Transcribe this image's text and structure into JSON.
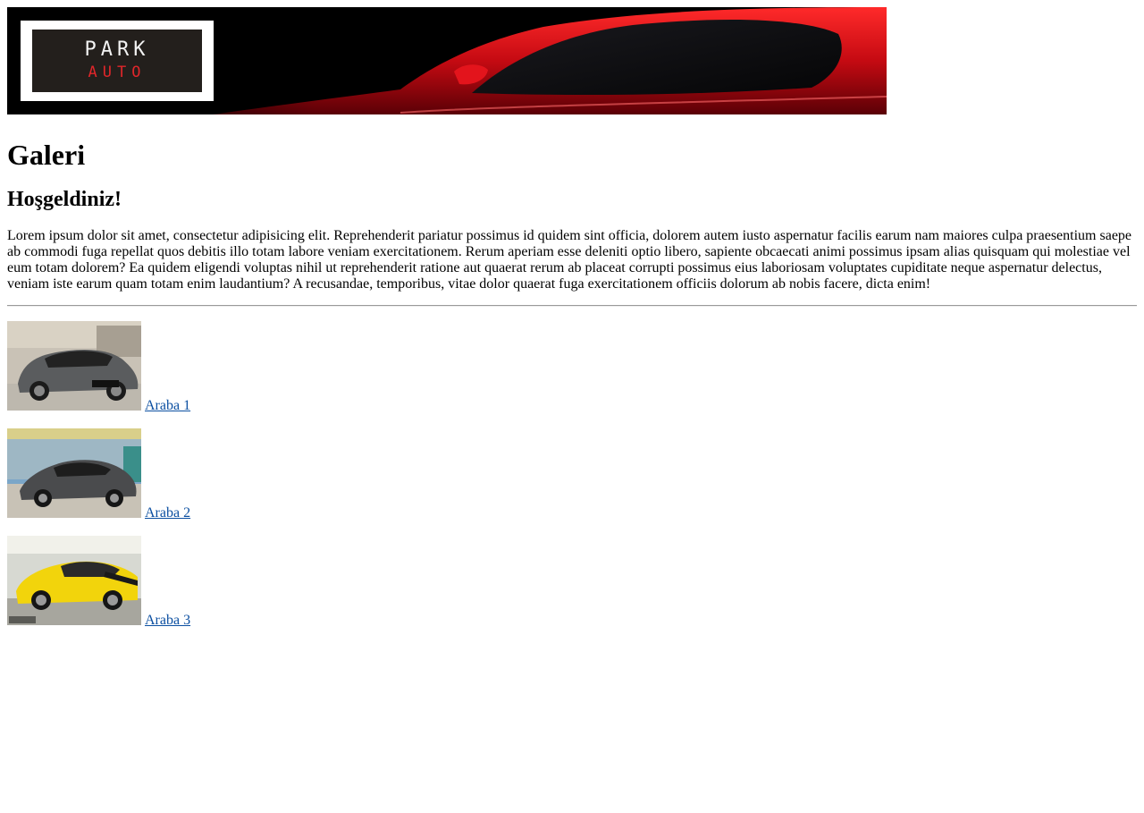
{
  "banner": {
    "logo_top": "PARK",
    "logo_bottom": "AUTO"
  },
  "page": {
    "title": "Galeri",
    "welcome": "Hoşgeldiniz!",
    "intro": "Lorem ipsum dolor sit amet, consectetur adipisicing elit. Reprehenderit pariatur possimus id quidem sint officia, dolorem autem iusto aspernatur facilis earum nam maiores culpa praesentium saepe ab commodi fuga repellat quos debitis illo totam labore veniam exercitationem. Rerum aperiam esse deleniti optio libero, sapiente obcaecati animi possimus ipsam alias quisquam qui molestiae vel eum totam dolorem? Ea quidem eligendi voluptas nihil ut reprehenderit ratione aut quaerat rerum ab placeat corrupti possimus eius laboriosam voluptates cupiditate neque aspernatur delectus, veniam iste earum quam totam enim laudantium? A recusandae, temporibus, vitae dolor quaerat fuga exercitationem officiis dolorum ab nobis facere, dicta enim!"
  },
  "gallery": {
    "items": [
      {
        "label": "Araba 1",
        "car_color": "#5a5c5e"
      },
      {
        "label": "Araba 2",
        "car_color": "#4a4b4d"
      },
      {
        "label": "Araba 3",
        "car_color": "#f2d40c"
      }
    ]
  },
  "colors": {
    "link": "#0b4fa1",
    "banner_red": "#d4101a"
  }
}
